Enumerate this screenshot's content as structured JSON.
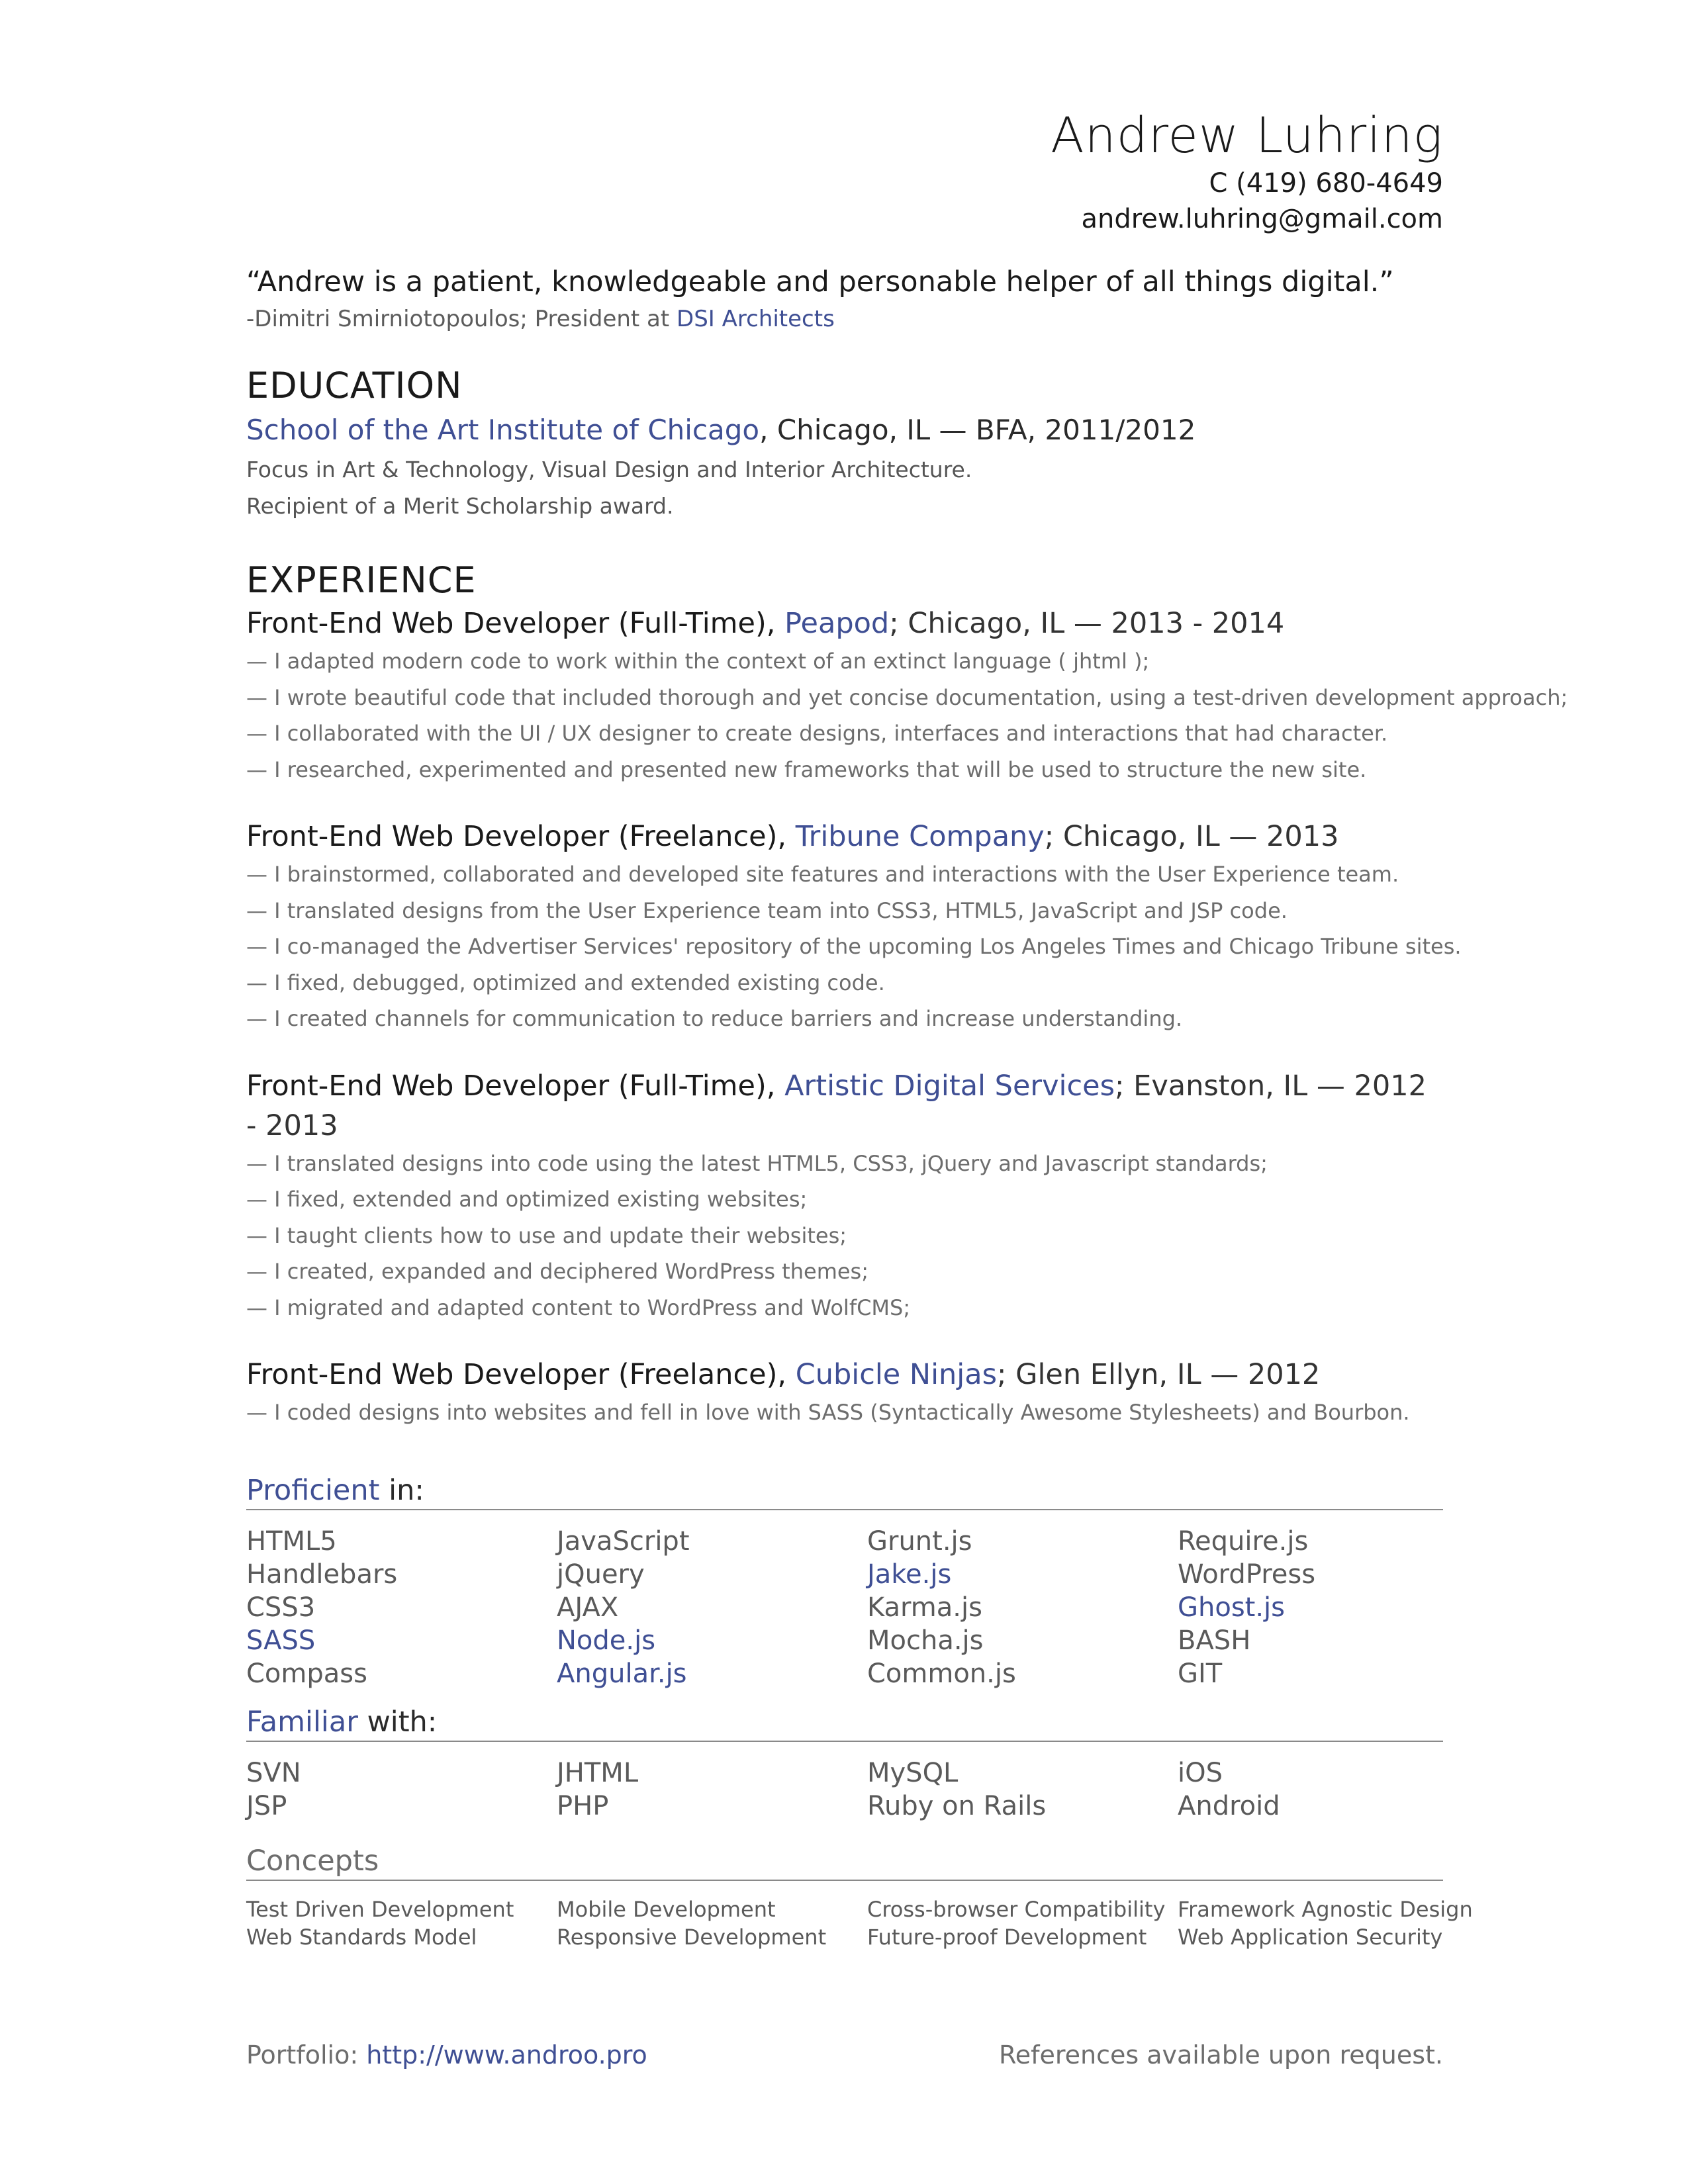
{
  "header": {
    "name": "Andrew Luhring",
    "phone": "C (419)  680-4649",
    "email": "andrew.luhring@gmail.com"
  },
  "quote": {
    "text": "“Andrew is a patient, knowledgeable and personable helper of all things digital.”",
    "attribution_prefix": "-Dimitri Smirniotopoulos; President at ",
    "attribution_link": "DSI Architects"
  },
  "education": {
    "heading": "EDUCATION",
    "school": "School of the Art Institute of Chicago",
    "details": ", Chicago, IL — BFA, 2011/2012",
    "lines": [
      "Focus in Art & Technology, Visual Design and Interior Architecture.",
      "Recipient of a Merit Scholarship award."
    ]
  },
  "experience": {
    "heading": "EXPERIENCE",
    "jobs": [
      {
        "role": "Front-End Web Developer (Full-Time), ",
        "company": "Peapod",
        "place": "; Chicago, IL — 2013 - 2014",
        "bullets": [
          "— I adapted modern code to work within the context of an extinct language ( jhtml );",
          "— I wrote beautiful code that included thorough and yet concise documentation, using a test-driven development approach;",
          "— I collaborated with the UI / UX designer to create designs, interfaces and interactions that had character.",
          "— I researched, experimented and presented new frameworks that will be used to structure the new site."
        ]
      },
      {
        "role": "Front-End Web Developer (Freelance), ",
        "company": "Tribune Company",
        "place": "; Chicago, IL — 2013",
        "bullets": [
          "— I brainstormed, collaborated and developed site features and interactions with the User Experience team.",
          "— I translated designs from the User Experience team into CSS3, HTML5, JavaScript and JSP code.",
          "— I co-managed the Advertiser Services' repository of the upcoming Los Angeles Times and Chicago Tribune sites.",
          "— I fixed, debugged, optimized and extended existing code.",
          "— I created channels for communication to reduce barriers and increase understanding."
        ]
      },
      {
        "role": "Front-End Web Developer (Full-Time), ",
        "company": "Artistic Digital Services",
        "place": "; Evanston, IL — 2012 - 2013",
        "bullets": [
          "— I translated designs into code using the latest HTML5, CSS3, jQuery and Javascript standards;",
          "— I fixed, extended and optimized existing websites;",
          "— I taught clients how to use and update their websites;",
          "— I created, expanded and deciphered WordPress themes;",
          "— I migrated and adapted content to WordPress and WolfCMS;"
        ]
      },
      {
        "role": "Front-End Web Developer (Freelance), ",
        "company": "Cubicle Ninjas",
        "place": "; Glen Ellyn, IL — 2012",
        "bullets": [
          "— I coded designs into websites and fell in love with SASS (Syntactically Awesome Stylesheets) and Bourbon."
        ]
      }
    ]
  },
  "proficient": {
    "heading_link": "Proficient",
    "heading_rest": " in:",
    "columns": [
      [
        "HTML5",
        "Handlebars",
        "CSS3",
        "SASS",
        "Compass"
      ],
      [
        "JavaScript",
        "jQuery",
        "AJAX",
        "Node.js",
        "Angular.js"
      ],
      [
        "Grunt.js",
        "Jake.js",
        "Karma.js",
        "Mocha.js",
        "Common.js"
      ],
      [
        "Require.js",
        "WordPress",
        "Ghost.js",
        "BASH",
        "GIT"
      ]
    ]
  },
  "familiar": {
    "heading_link": "Familiar",
    "heading_rest": " with:",
    "columns": [
      [
        "SVN",
        "JSP"
      ],
      [
        "JHTML",
        "PHP"
      ],
      [
        "MySQL",
        "Ruby on Rails"
      ],
      [
        "iOS",
        "Android"
      ]
    ]
  },
  "concepts": {
    "heading": "Concepts",
    "columns": [
      [
        "Test Driven Development",
        "Web Standards Model"
      ],
      [
        "Mobile Development",
        "Responsive Development"
      ],
      [
        "Cross-browser Compatibility",
        "Future-proof Development"
      ],
      [
        "Framework Agnostic Design",
        "Web Application Security"
      ]
    ]
  },
  "footer": {
    "portfolio_label": "Portfolio: ",
    "portfolio_url": "http://www.androo.pro",
    "references": "References available upon request."
  }
}
